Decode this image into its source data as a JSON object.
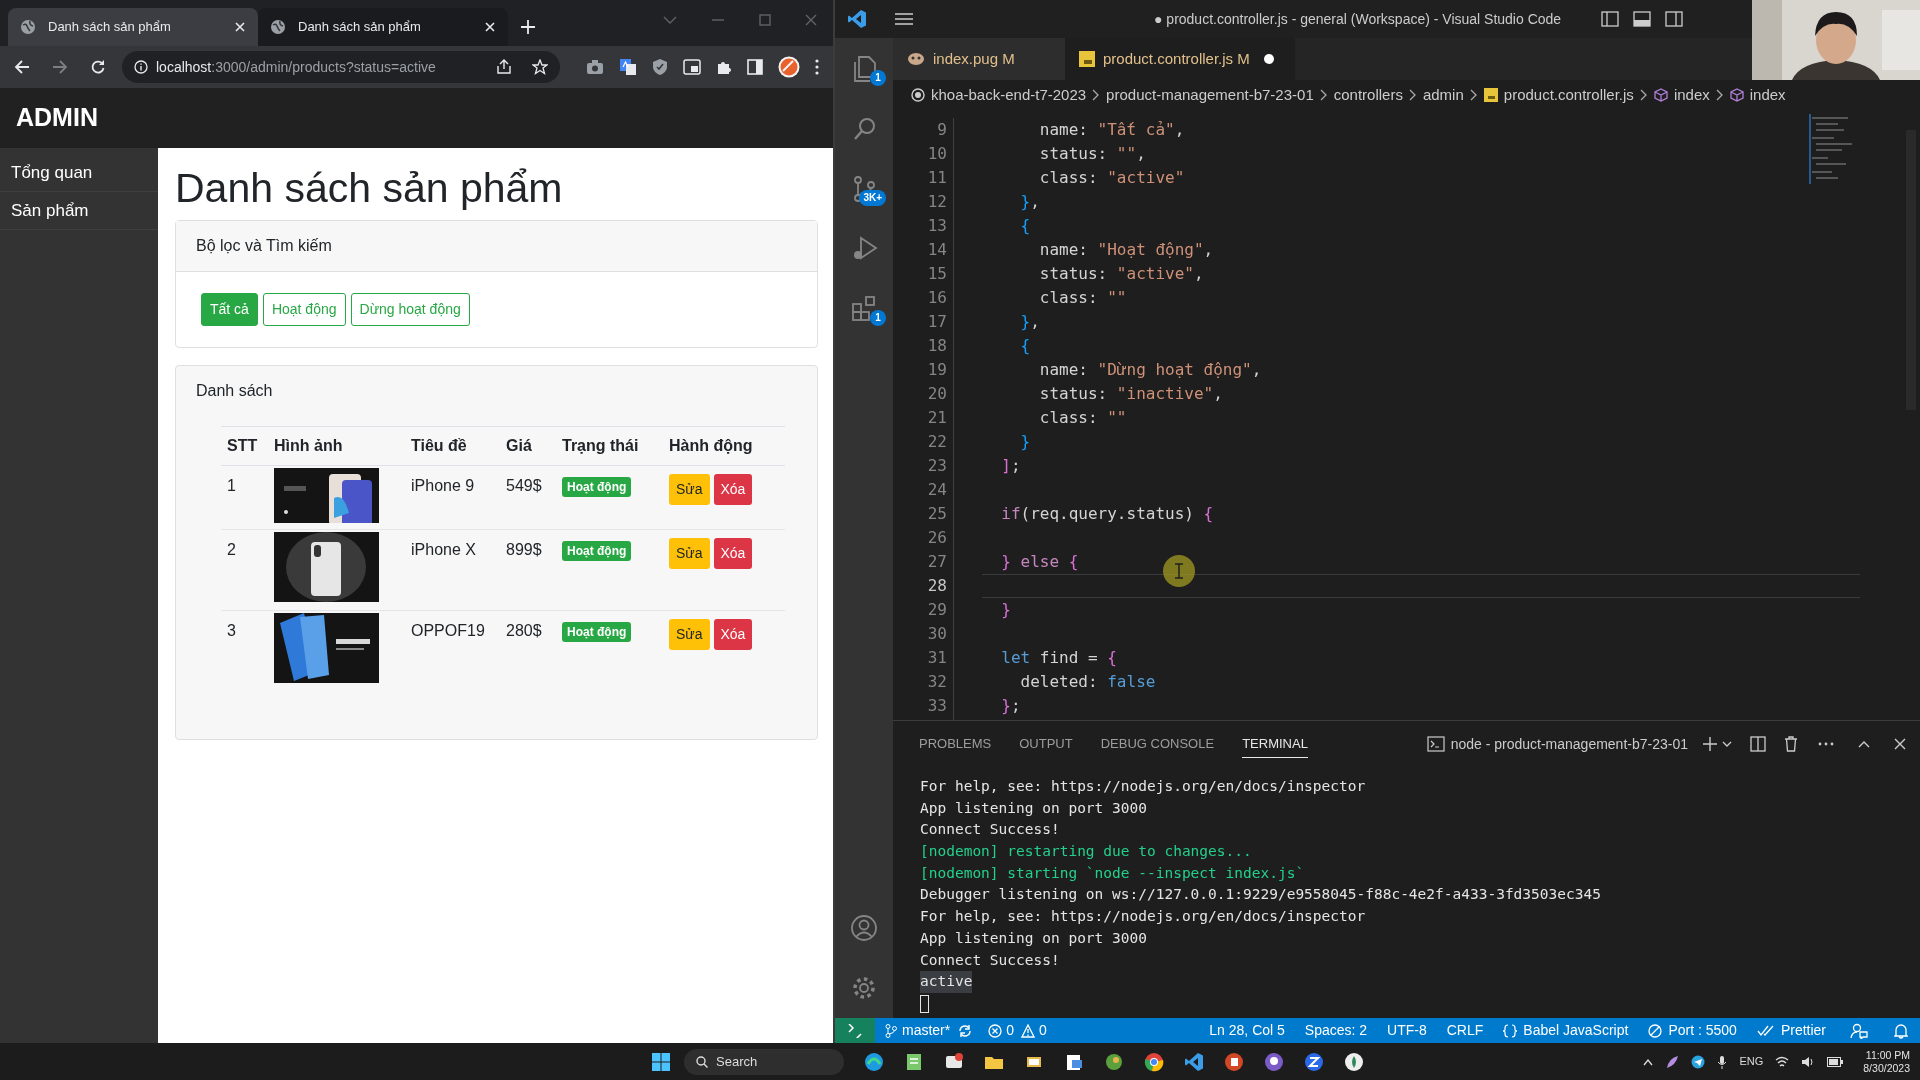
{
  "browser": {
    "tabs": [
      {
        "title": "Danh sách sản phẩm",
        "selected": true
      },
      {
        "title": "Danh sách sản phẩm",
        "selected": false
      }
    ],
    "url": {
      "host": "localhost",
      "path": ":3000/admin/products?status=active"
    },
    "page": {
      "brand": "ADMIN",
      "menu": [
        {
          "label": "Tổng quan"
        },
        {
          "label": "Sản phẩm"
        }
      ],
      "title": "Danh sách sản phẩm",
      "filter_card": {
        "header": "Bộ lọc và Tìm kiếm",
        "buttons": [
          {
            "label": "Tất cả",
            "selected": true
          },
          {
            "label": "Hoạt động",
            "selected": false
          },
          {
            "label": "Dừng hoạt động",
            "selected": false
          }
        ]
      },
      "list_card": {
        "header": "Danh sách",
        "columns": [
          "STT",
          "Hình ảnh",
          "Tiêu đề",
          "Giá",
          "Trạng thái",
          "Hành động"
        ],
        "rows": [
          {
            "index": "1",
            "title": "iPhone 9",
            "price": "549$",
            "status": "Hoạt động",
            "edit": "Sửa",
            "delete": "Xóa"
          },
          {
            "index": "2",
            "title": "iPhone X",
            "price": "899$",
            "status": "Hoạt động",
            "edit": "Sửa",
            "delete": "Xóa"
          },
          {
            "index": "3",
            "title": "OPPOF19",
            "price": "280$",
            "status": "Hoạt động",
            "edit": "Sửa",
            "delete": "Xóa"
          }
        ]
      }
    }
  },
  "vscode": {
    "title": "● product.controller.js - general (Workspace) - Visual Studio Code",
    "activity_bar": {
      "top": [
        {
          "kind": "explorer",
          "badge": "1"
        },
        {
          "kind": "search"
        },
        {
          "kind": "source-control",
          "badge": "3K+"
        },
        {
          "kind": "run"
        },
        {
          "kind": "extensions",
          "badge": "1"
        }
      ],
      "bottom": [
        {
          "kind": "account"
        },
        {
          "kind": "settings"
        }
      ]
    },
    "editor_tabs": [
      {
        "label": "index.pug",
        "kind": "pug",
        "badge": "M",
        "selected": false,
        "modified": false
      },
      {
        "label": "product.controller.js",
        "kind": "js",
        "badge": "M",
        "selected": true,
        "modified": true
      }
    ],
    "breadcrumb": [
      {
        "label": "khoa-back-end-t7-2023",
        "kind": "root"
      },
      {
        "label": "product-management-b7-23-01",
        "kind": "folder"
      },
      {
        "label": "controllers",
        "kind": "folder"
      },
      {
        "label": "admin",
        "kind": "folder"
      },
      {
        "label": "product.controller.js",
        "kind": "js"
      },
      {
        "label": "index",
        "kind": "symbol"
      },
      {
        "label": "index",
        "kind": "symbol"
      }
    ],
    "code": [
      {
        "number": "9",
        "tokens": [
          {
            "text": "      name: ",
            "kind": "plain"
          },
          {
            "text": "\"Tất cả\"",
            "kind": "string"
          },
          {
            "text": ",",
            "kind": "plain"
          }
        ]
      },
      {
        "number": "10",
        "tokens": [
          {
            "text": "      status: ",
            "kind": "plain"
          },
          {
            "text": "\"\"",
            "kind": "string"
          },
          {
            "text": ",",
            "kind": "plain"
          }
        ]
      },
      {
        "number": "11",
        "tokens": [
          {
            "text": "      class: ",
            "kind": "plain"
          },
          {
            "text": "\"active\"",
            "kind": "string"
          }
        ]
      },
      {
        "number": "12",
        "tokens": [
          {
            "text": "    }",
            "kind": "bracket-blue"
          },
          {
            "text": ",",
            "kind": "plain"
          }
        ]
      },
      {
        "number": "13",
        "tokens": [
          {
            "text": "    {",
            "kind": "bracket-blue"
          }
        ]
      },
      {
        "number": "14",
        "tokens": [
          {
            "text": "      name: ",
            "kind": "plain"
          },
          {
            "text": "\"Hoạt động\"",
            "kind": "string"
          },
          {
            "text": ",",
            "kind": "plain"
          }
        ]
      },
      {
        "number": "15",
        "tokens": [
          {
            "text": "      status: ",
            "kind": "plain"
          },
          {
            "text": "\"active\"",
            "kind": "string"
          },
          {
            "text": ",",
            "kind": "plain"
          }
        ]
      },
      {
        "number": "16",
        "tokens": [
          {
            "text": "      class: ",
            "kind": "plain"
          },
          {
            "text": "\"\"",
            "kind": "string"
          }
        ]
      },
      {
        "number": "17",
        "tokens": [
          {
            "text": "    }",
            "kind": "bracket-blue"
          },
          {
            "text": ",",
            "kind": "plain"
          }
        ]
      },
      {
        "number": "18",
        "tokens": [
          {
            "text": "    {",
            "kind": "bracket-blue"
          }
        ]
      },
      {
        "number": "19",
        "tokens": [
          {
            "text": "      name: ",
            "kind": "plain"
          },
          {
            "text": "\"Dừng hoạt động\"",
            "kind": "string"
          },
          {
            "text": ",",
            "kind": "plain"
          }
        ]
      },
      {
        "number": "20",
        "tokens": [
          {
            "text": "      status: ",
            "kind": "plain"
          },
          {
            "text": "\"inactive\"",
            "kind": "string"
          },
          {
            "text": ",",
            "kind": "plain"
          }
        ]
      },
      {
        "number": "21",
        "tokens": [
          {
            "text": "      class: ",
            "kind": "plain"
          },
          {
            "text": "\"\"",
            "kind": "string"
          }
        ]
      },
      {
        "number": "22",
        "tokens": [
          {
            "text": "    }",
            "kind": "bracket-blue"
          }
        ]
      },
      {
        "number": "23",
        "tokens": [
          {
            "text": "  ]",
            "kind": "bracket-pink"
          },
          {
            "text": ";",
            "kind": "plain"
          }
        ]
      },
      {
        "number": "24",
        "current": false
      },
      {
        "number": "25",
        "tokens": [
          {
            "text": "  if",
            "kind": "control"
          },
          {
            "text": "(req.query.status) ",
            "kind": "plain"
          },
          {
            "text": "{",
            "kind": "bracket-pink"
          }
        ]
      },
      {
        "number": "26",
        "current": false
      },
      {
        "number": "27",
        "tokens": [
          {
            "text": "  }",
            "kind": "bracket-pink"
          },
          {
            "text": " else",
            "kind": "control"
          },
          {
            "text": " {",
            "kind": "bracket-pink"
          }
        ]
      },
      {
        "number": "28",
        "current": true
      },
      {
        "number": "29",
        "tokens": [
          {
            "text": "  }",
            "kind": "bracket-pink"
          }
        ]
      },
      {
        "number": "30",
        "current": false
      },
      {
        "number": "31",
        "tokens": [
          {
            "text": "  let",
            "kind": "keyword"
          },
          {
            "text": " find = ",
            "kind": "plain"
          },
          {
            "text": "{",
            "kind": "bracket-pink"
          }
        ]
      },
      {
        "number": "32",
        "tokens": [
          {
            "text": "    deleted: ",
            "kind": "plain"
          },
          {
            "text": "false",
            "kind": "keyword"
          }
        ]
      },
      {
        "number": "33",
        "tokens": [
          {
            "text": "  }",
            "kind": "bracket-pink"
          },
          {
            "text": ";",
            "kind": "plain"
          }
        ]
      }
    ],
    "panel": {
      "tabs": [
        {
          "label": "PROBLEMS",
          "selected": false
        },
        {
          "label": "OUTPUT",
          "selected": false
        },
        {
          "label": "DEBUG CONSOLE",
          "selected": false
        },
        {
          "label": "TERMINAL",
          "selected": true
        }
      ],
      "terminal_name": "node - product-management-b7-23-01",
      "lines": [
        {
          "text": "For help, see: https://nodejs.org/en/docs/inspector",
          "kind": "output"
        },
        {
          "text": "App listening on port 3000",
          "kind": "output"
        },
        {
          "text": "Connect Success!",
          "kind": "output"
        },
        {
          "text": "[nodemon] restarting due to changes...",
          "kind": "nodemon"
        },
        {
          "text": "[nodemon] starting `node --inspect index.js`",
          "kind": "nodemon"
        },
        {
          "text": "Debugger listening on ws://127.0.0.1:9229/e9558045-f88c-4e2f-a433-3fd3503ec345",
          "kind": "output"
        },
        {
          "text": "For help, see: https://nodejs.org/en/docs/inspector",
          "kind": "output"
        },
        {
          "text": "App listening on port 3000",
          "kind": "output"
        },
        {
          "text": "Connect Success!",
          "kind": "output"
        },
        {
          "text": "active",
          "kind": "highlighted"
        }
      ]
    },
    "status_bar": {
      "branch": "master*",
      "errors": "0",
      "warnings": "0",
      "items": [
        {
          "kind": "text",
          "label": "Ln 28, Col 5"
        },
        {
          "kind": "text",
          "label": "Spaces: 2"
        },
        {
          "kind": "text",
          "label": "UTF-8"
        },
        {
          "kind": "text",
          "label": "CRLF"
        },
        {
          "kind": "braces",
          "label": "Babel JavaScript"
        },
        {
          "kind": "port",
          "label": "Port : 5500"
        },
        {
          "kind": "check",
          "label": "Prettier"
        }
      ]
    }
  },
  "taskbar": {
    "search": "Search",
    "language": "ENG",
    "time": "11:00 PM",
    "date": "8/30/2023"
  }
}
